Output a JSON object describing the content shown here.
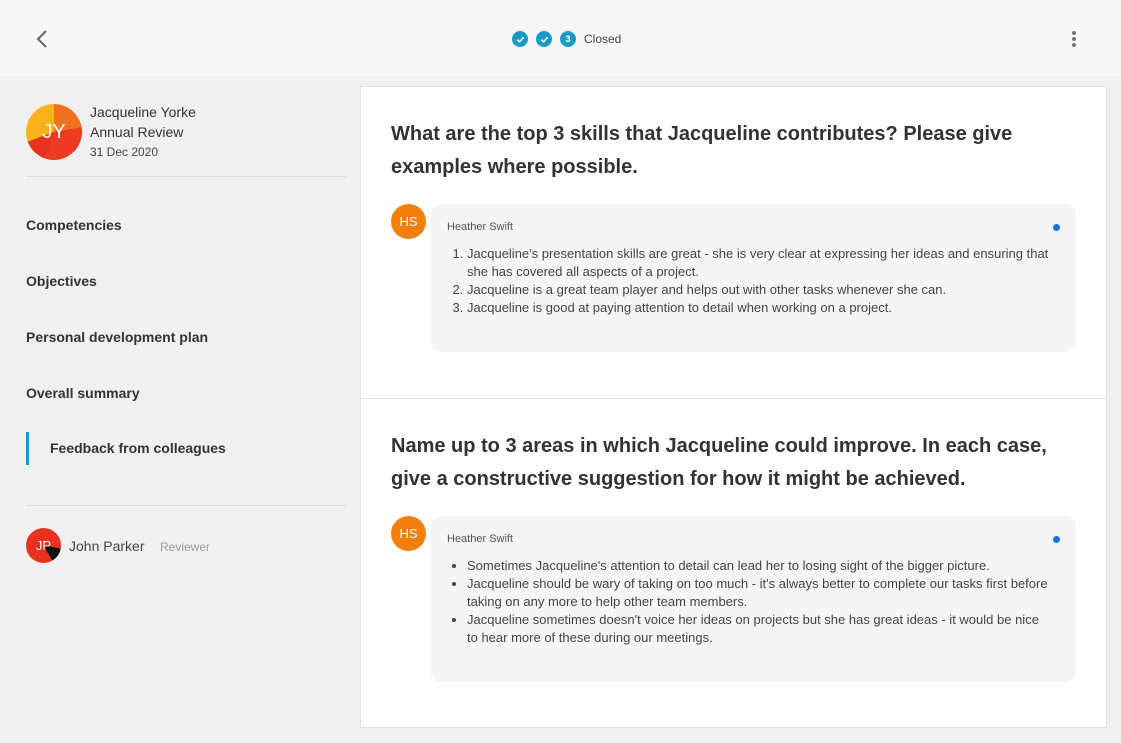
{
  "header": {
    "steps": [
      {
        "type": "check"
      },
      {
        "type": "check"
      },
      {
        "type": "number",
        "label": "3"
      }
    ],
    "status": "Closed"
  },
  "profile": {
    "initials": "JY",
    "name": "Jacqueline Yorke",
    "review_type": "Annual Review",
    "date": "31 Dec 2020"
  },
  "nav": {
    "items": [
      {
        "label": "Competencies"
      },
      {
        "label": "Objectives"
      },
      {
        "label": "Personal development plan"
      },
      {
        "label": "Overall summary"
      },
      {
        "label": "Feedback from colleagues"
      }
    ]
  },
  "reviewer": {
    "initials": "JP",
    "name": "John Parker",
    "role": "Reviewer"
  },
  "questions": [
    {
      "text": "What are the top 3 skills that Jacqueline contributes? Please give examples where possible.",
      "response": {
        "initials": "HS",
        "author": "Heather Swift",
        "items": [
          "Jacqueline's presentation skills are great - she is very clear at expressing her ideas and ensuring that she has covered all aspects of a project.",
          "Jacqueline is a great team player and helps out with other tasks whenever she can.",
          "Jacqueline is good at paying attention to detail when working on a project."
        ]
      }
    },
    {
      "text": "Name up to 3 areas in which Jacqueline could improve. In each case, give a constructive suggestion for how it might be achieved.",
      "response": {
        "initials": "HS",
        "author": "Heather Swift",
        "items": [
          "Sometimes Jacqueline's attention to detail can lead her to losing sight of the bigger picture.",
          "Jacqueline should be wary of taking on too much - it's always better to complete our tasks first before taking on any more to help other team members.",
          "Jacqueline sometimes doesn't voice her ideas on projects but she has great ideas - it would be nice to hear more of these during our meetings."
        ]
      }
    }
  ],
  "colors": {
    "accent": "#1a9bc7",
    "unread_dot": "#1473e6",
    "hs_avatar": "#f37f0e"
  }
}
